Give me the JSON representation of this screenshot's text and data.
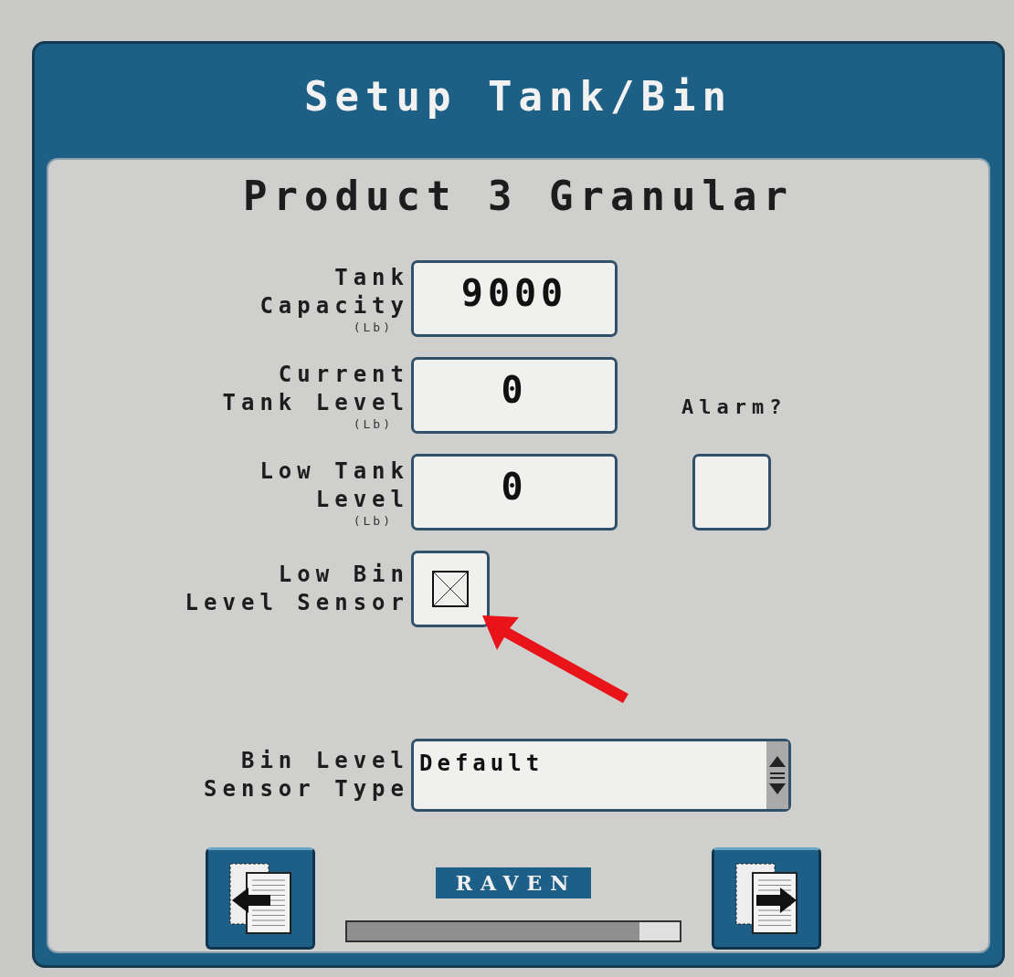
{
  "window": {
    "title": "Setup Tank/Bin"
  },
  "product": {
    "title": "Product 3 Granular"
  },
  "fields": [
    {
      "label_lines": [
        "Tank",
        "Capacity"
      ],
      "unit": "(Lb)",
      "value": "9000"
    },
    {
      "label_lines": [
        "Current",
        "Tank Level"
      ],
      "unit": "(Lb)",
      "value": "0"
    },
    {
      "label_lines": [
        "Low Tank",
        "Level"
      ],
      "unit": "(Lb)",
      "value": "0"
    }
  ],
  "alarm": {
    "label": "Alarm?",
    "checked": false
  },
  "low_bin_sensor": {
    "label_lines": [
      "Low Bin",
      "Level Sensor"
    ],
    "checked": true
  },
  "sensor_type": {
    "label_lines": [
      "Bin Level",
      "Sensor Type"
    ],
    "value": "Default"
  },
  "logo": {
    "text": "RAVEN"
  },
  "progress": {
    "level": 0.88
  }
}
